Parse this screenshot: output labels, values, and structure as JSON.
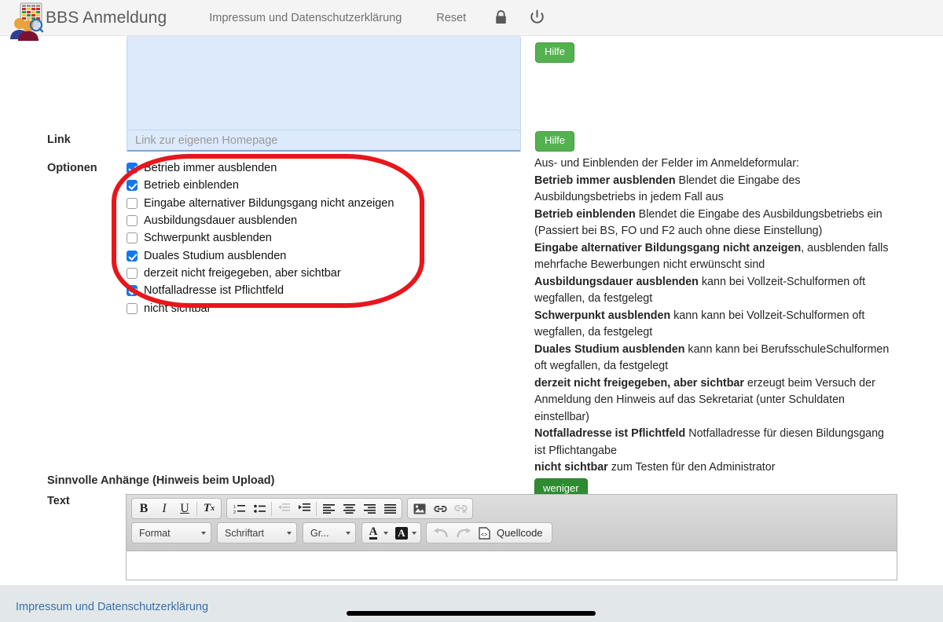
{
  "navbar": {
    "brand_title": "BBS Anmeldung",
    "logo_icon": "people-table-magnifier-logo",
    "links": [
      {
        "label": "Impressum und Datenschutzerklärung",
        "name": "nav-link-impressum"
      },
      {
        "label": "Reset",
        "name": "nav-link-reset"
      }
    ],
    "icons": [
      {
        "name": "lock-icon",
        "glyph": "lock"
      },
      {
        "name": "power-icon",
        "glyph": "power"
      }
    ]
  },
  "form": {
    "textarea": {
      "label": "",
      "value": "",
      "placeholder": ""
    },
    "link_row": {
      "label": "Link",
      "placeholder": "Link zur eigenen Homepage",
      "value": ""
    },
    "options_row": {
      "label": "Optionen"
    },
    "hilfe_label": "Hilfe",
    "weniger_label": "weniger",
    "attachments_heading": "Sinnvolle Anhänge (Hinweis beim Upload)",
    "text_label": "Text"
  },
  "options": [
    {
      "label": "Betrieb immer ausblenden",
      "checked": true
    },
    {
      "label": "Betrieb einblenden",
      "checked": true
    },
    {
      "label": "Eingabe alternativer Bildungsgang nicht anzeigen",
      "checked": false
    },
    {
      "label": "Ausbildungsdauer ausblenden",
      "checked": false
    },
    {
      "label": "Schwerpunkt ausblenden",
      "checked": false
    },
    {
      "label": "Duales Studium ausblenden",
      "checked": true
    },
    {
      "label": "derzeit nicht freigegeben, aber sichtbar",
      "checked": false
    },
    {
      "label": "Notfalladresse ist Pflichtfeld",
      "checked": true
    },
    {
      "label": "nicht sichtbar",
      "checked": false
    }
  ],
  "help": {
    "intro": "Aus- und Einblenden der Felder im Anmeldeformular:",
    "entries": [
      {
        "term": "Betrieb immer ausblenden",
        "desc": " Blendet die Eingabe des Ausbildungsbetriebs in jedem Fall aus"
      },
      {
        "term": "Betrieb einblenden",
        "desc": " Blendet die Eingabe des Ausbildungsbetriebs ein (Passiert bei BS, FO und F2 auch ohne diese Einstellung)"
      },
      {
        "term": "Eingabe alternativer Bildungsgang nicht anzeigen",
        "desc": ", ausblenden falls mehrfache Bewerbungen nicht erwünscht sind"
      },
      {
        "term": "Ausbildungsdauer ausblenden",
        "desc": " kann bei Vollzeit-Schulformen oft wegfallen, da festgelegt"
      },
      {
        "term": "Schwerpunkt ausblenden",
        "desc": " kann kann bei Vollzeit-Schulformen oft wegfallen, da festgelegt"
      },
      {
        "term": "Duales Studium ausblenden",
        "desc": " kann kann bei BerufsschuleSchulformen oft wegfallen, da festgelegt"
      },
      {
        "term": "derzeit nicht freigegeben, aber sichtbar",
        "desc": " erzeugt beim Versuch der Anmeldung den Hinweis auf das Sekretariat (unter Schuldaten einstellbar)"
      },
      {
        "term": "Notfalladresse ist Pflichtfeld",
        "desc": " Notfalladresse für diesen Bildungsgang ist Pflichtangabe"
      },
      {
        "term": "nicht sichtbar",
        "desc": " zum Testen für den Administrator"
      }
    ]
  },
  "editor": {
    "toolbar_row1": [
      {
        "name": "bold-icon",
        "glyph": "B"
      },
      {
        "name": "italic-icon",
        "glyph": "I"
      },
      {
        "name": "underline-icon",
        "glyph": "U"
      },
      {
        "name": "remove-format-icon",
        "glyph": "Tx"
      },
      {
        "name": "numbered-list-icon",
        "glyph": "ol"
      },
      {
        "name": "bulleted-list-icon",
        "glyph": "ul"
      },
      {
        "name": "outdent-icon",
        "glyph": "outdent"
      },
      {
        "name": "indent-icon",
        "glyph": "indent"
      },
      {
        "name": "align-left-icon",
        "glyph": "align-left"
      },
      {
        "name": "align-center-icon",
        "glyph": "align-center"
      },
      {
        "name": "align-right-icon",
        "glyph": "align-right"
      },
      {
        "name": "justify-icon",
        "glyph": "justify"
      },
      {
        "name": "image-icon",
        "glyph": "image"
      },
      {
        "name": "link-icon",
        "glyph": "link"
      },
      {
        "name": "unlink-icon",
        "glyph": "unlink"
      }
    ],
    "combo_format": "Format",
    "combo_font": "Schriftart",
    "combo_size": "Gr...",
    "text_color_label": "A",
    "bg_color_label": "A",
    "undo_icon": "undo-icon",
    "redo_icon": "redo-icon",
    "source_label": "Quellcode",
    "content": ""
  },
  "footer": {
    "link_label": "Impressum und Datenschutzerklärung"
  },
  "colors": {
    "navbar_bg": "#f4f4f4",
    "accent_green": "#53b14f",
    "accent_green_dark": "#2f8b32",
    "checkbox_blue": "#1577ee",
    "input_bg": "#ddeafb",
    "annotation_red": "#e8161b",
    "footer_bg": "#e2e8ea",
    "link_blue": "#3b6fa8"
  }
}
